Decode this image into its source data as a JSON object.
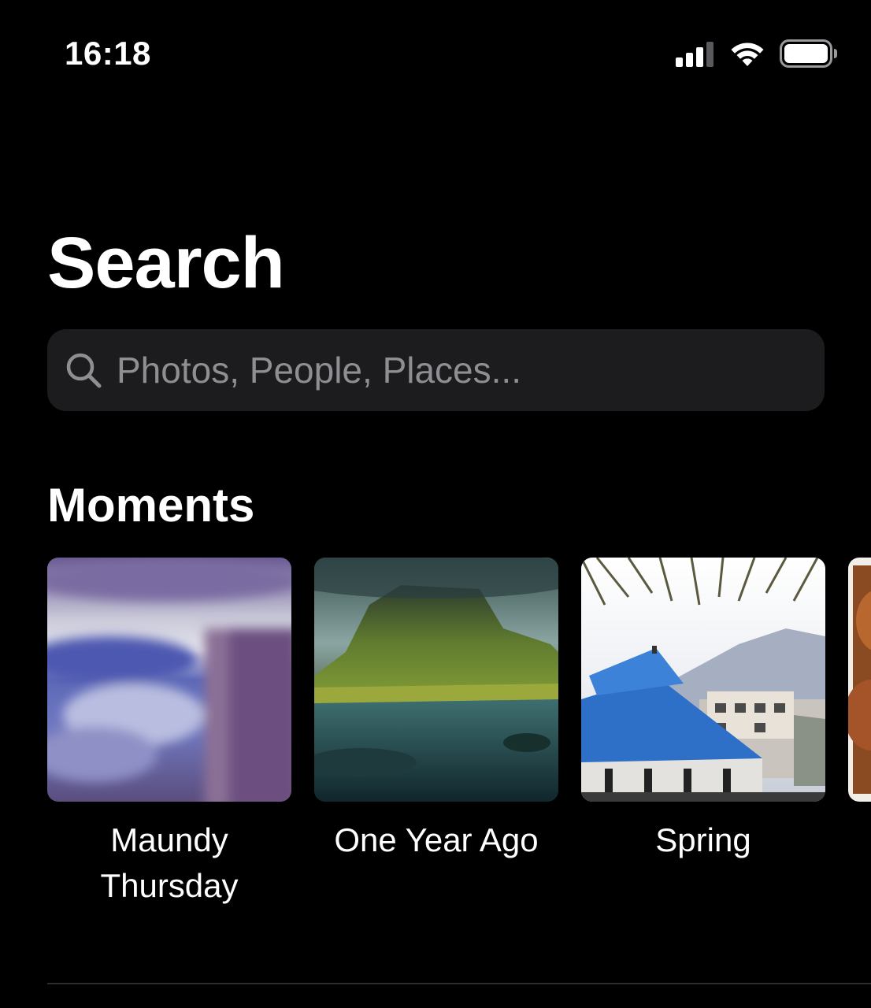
{
  "status_bar": {
    "time": "16:18",
    "signal_icon": "cellular-signal-icon",
    "wifi_icon": "wifi-icon",
    "battery_icon": "battery-icon"
  },
  "header": {
    "title": "Search"
  },
  "search": {
    "placeholder": "Photos, People, Places...",
    "value": "",
    "icon": "magnifying-glass-icon"
  },
  "moments": {
    "section_title": "Moments",
    "items": [
      {
        "label": "Maundy\nThursday",
        "thumbnail": "blurry-blue-sky-photo"
      },
      {
        "label": "One Year Ago",
        "thumbnail": "green-mountain-river-landscape-photo"
      },
      {
        "label": "Spring",
        "thumbnail": "blue-roof-pagoda-mountain-photo"
      },
      {
        "label": "",
        "thumbnail": "food-photo-partial"
      }
    ]
  },
  "colors": {
    "background": "#000000",
    "search_field": "#1c1c1e",
    "placeholder": "#8e8e93",
    "text": "#ffffff"
  }
}
